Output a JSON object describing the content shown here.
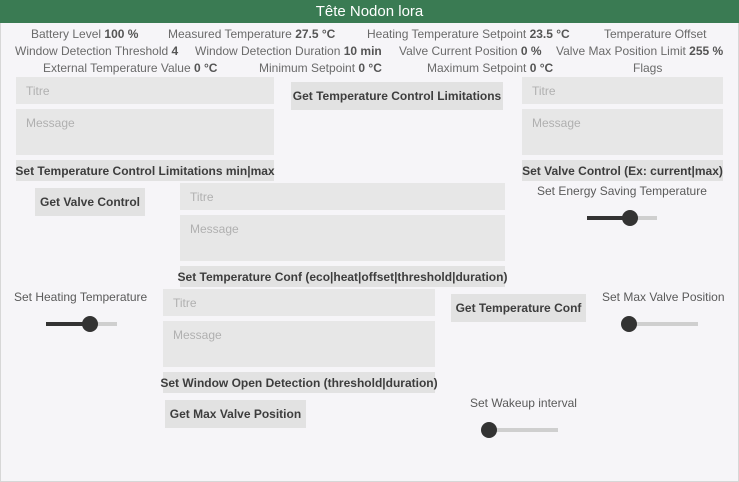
{
  "header": {
    "title": "Tête Nodon lora"
  },
  "stats": {
    "battery": {
      "label": "Battery Level",
      "value": "100 %"
    },
    "measured_temp": {
      "label": "Measured Temperature",
      "value": "27.5 °C"
    },
    "heating_setpoint": {
      "label": "Heating Temperature Setpoint",
      "value": "23.5 °C"
    },
    "temp_offset": {
      "label": "Temperature Offset",
      "value": ""
    },
    "window_threshold": {
      "label": "Window Detection Threshold",
      "value": "4"
    },
    "window_duration": {
      "label": "Window Detection Duration",
      "value": "10 min"
    },
    "valve_position": {
      "label": "Valve Current Position",
      "value": "0 %"
    },
    "valve_max_limit": {
      "label": "Valve Max Position Limit",
      "value": "255 %"
    },
    "external_temp": {
      "label": "External Temperature Value",
      "value": "0 °C"
    },
    "min_setpoint": {
      "label": "Minimum Setpoint",
      "value": "0 °C"
    },
    "max_setpoint": {
      "label": "Maximum Setpoint",
      "value": "0 °C"
    },
    "flags": {
      "label": "Flags",
      "value": ""
    }
  },
  "forms": {
    "limits": {
      "title_placeholder": "Titre",
      "message_placeholder": "Message",
      "button": "Set Temperature Control Limitations min|max"
    },
    "valve_control": {
      "title_placeholder": "Titre",
      "message_placeholder": "Message",
      "button": "Set Valve Control (Ex: current|max)"
    },
    "temp_conf": {
      "title_placeholder": "Titre",
      "message_placeholder": "Message",
      "button": "Set Temperature Conf (eco|heat|offset|threshold|duration)"
    },
    "window_detection": {
      "title_placeholder": "Titre",
      "message_placeholder": "Message",
      "button": "Set Window Open Detection (threshold|duration)"
    }
  },
  "buttons": {
    "get_limitations": "Get Temperature Control Limitations",
    "get_valve_control": "Get Valve Control",
    "get_temp_conf": "Get Temperature Conf",
    "get_max_valve": "Get Max Valve Position"
  },
  "sliders": {
    "energy_saving": {
      "label": "Set Energy Saving Temperature",
      "value": 0.62
    },
    "heating": {
      "label": "Set Heating Temperature",
      "value": 0.62
    },
    "max_valve": {
      "label": "Set Max Valve Position",
      "value": 0.0
    },
    "wakeup": {
      "label": "Set Wakeup interval",
      "value": 0.0
    }
  }
}
